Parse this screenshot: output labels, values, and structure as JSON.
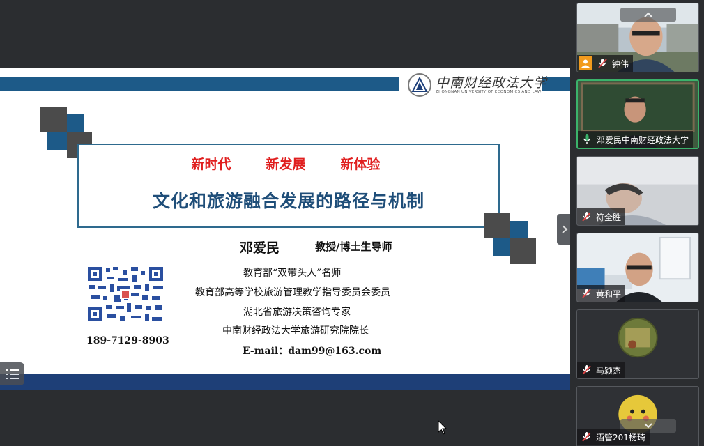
{
  "slide": {
    "logo_text": "中南财经政法大学",
    "logo_subtext": "ZHONGNAN UNIVERSITY OF ECONOMICS AND LAW",
    "subtitles": [
      "新时代",
      "新发展",
      "新体验"
    ],
    "title": "文化和旅游融合发展的路径与机制",
    "presenter_name": "邓爱民",
    "presenter_role": "教授/博士生导师",
    "credentials": [
      "教育部“双带头人”名师",
      "教育部高等学校旅游管理教学指导委员会委员",
      "湖北省旅游决策咨询专家",
      "中南财经政法大学旅游研究院院长",
      "E-mail：dam99@163.com"
    ],
    "phone": "189-7129-8903"
  },
  "participants": [
    {
      "name": "钟伟",
      "host": true
    },
    {
      "name": "邓爱民中南财经政法大学",
      "active": true
    },
    {
      "name": "符全胜"
    },
    {
      "name": "黄和平"
    },
    {
      "name": "马颖杰"
    },
    {
      "name": "酒管201杨琦"
    }
  ],
  "colors": {
    "accent_blue": "#1d5a88",
    "title_blue": "#1f4e79",
    "subtitle_red": "#e01f1f",
    "bottom_bar": "#1e3f77",
    "active_speaker": "#3bb36b",
    "host_badge": "#f29b1d"
  },
  "icons": {
    "mic": "microphone-icon",
    "host": "host-person-icon",
    "collapse": "chevron-right-icon",
    "toolbar": "menu-list-icon",
    "scroll_up": "chevron-up-icon",
    "scroll_down": "chevron-down-icon"
  }
}
